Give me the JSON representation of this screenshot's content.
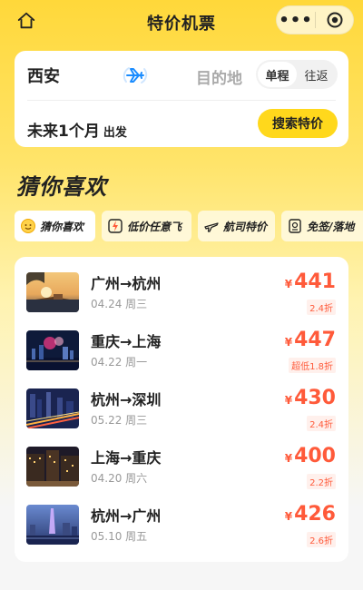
{
  "header": {
    "title": "特价机票",
    "more_label": "•••"
  },
  "search": {
    "from": "西安",
    "to_placeholder": "目的地",
    "trip_types": [
      "单程",
      "往返"
    ],
    "date_label": "未来1个月",
    "date_suffix": "出发",
    "search_button": "搜索特价"
  },
  "section": {
    "title": "猜你喜欢"
  },
  "tabs": [
    {
      "label": "猜你喜欢",
      "icon": "smile-face-icon"
    },
    {
      "label": "低价任意飞",
      "icon": "lightning-tag-icon"
    },
    {
      "label": "航司特价",
      "icon": "airplane-icon"
    },
    {
      "label": "免签/落地",
      "icon": "visa-icon"
    }
  ],
  "currency": "¥",
  "deals": [
    {
      "route": "广州→杭州",
      "date": "04.24 周三",
      "price": "441",
      "discount": "2.4折"
    },
    {
      "route": "重庆→上海",
      "date": "04.22 周一",
      "price": "447",
      "discount": "超低1.8折"
    },
    {
      "route": "杭州→深圳",
      "date": "05.22 周三",
      "price": "430",
      "discount": "2.4折"
    },
    {
      "route": "上海→重庆",
      "date": "04.20 周六",
      "price": "400",
      "discount": "2.2折"
    },
    {
      "route": "杭州→广州",
      "date": "05.10 周五",
      "price": "426",
      "discount": "2.6折"
    }
  ],
  "colors": {
    "accent": "#ffd81c",
    "price": "#ff5a3a"
  }
}
